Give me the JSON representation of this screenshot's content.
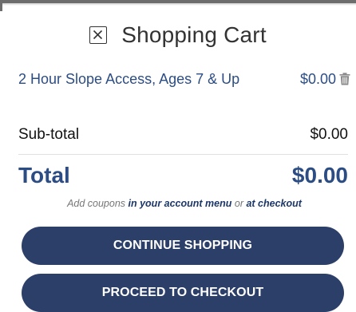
{
  "cart": {
    "title": "Shopping Cart",
    "close_icon": "close-box-icon",
    "items": [
      {
        "name": "2 Hour Slope Access, Ages 7 & Up",
        "price": "$0.00",
        "remove_icon": "trash-icon"
      }
    ],
    "subtotal_label": "Sub-total",
    "subtotal_value": "$0.00",
    "total_label": "Total",
    "total_value": "$0.00",
    "coupon_prefix": "Add coupons ",
    "coupon_link_account": "in your account menu",
    "coupon_or": " or ",
    "coupon_link_checkout": "at checkout",
    "continue_label": "CONTINUE SHOPPING",
    "checkout_label": "PROCEED TO CHECKOUT"
  },
  "colors": {
    "brand_blue": "#2c4d84",
    "button_navy": "#2c3f68",
    "button_text": "#ffffff"
  }
}
